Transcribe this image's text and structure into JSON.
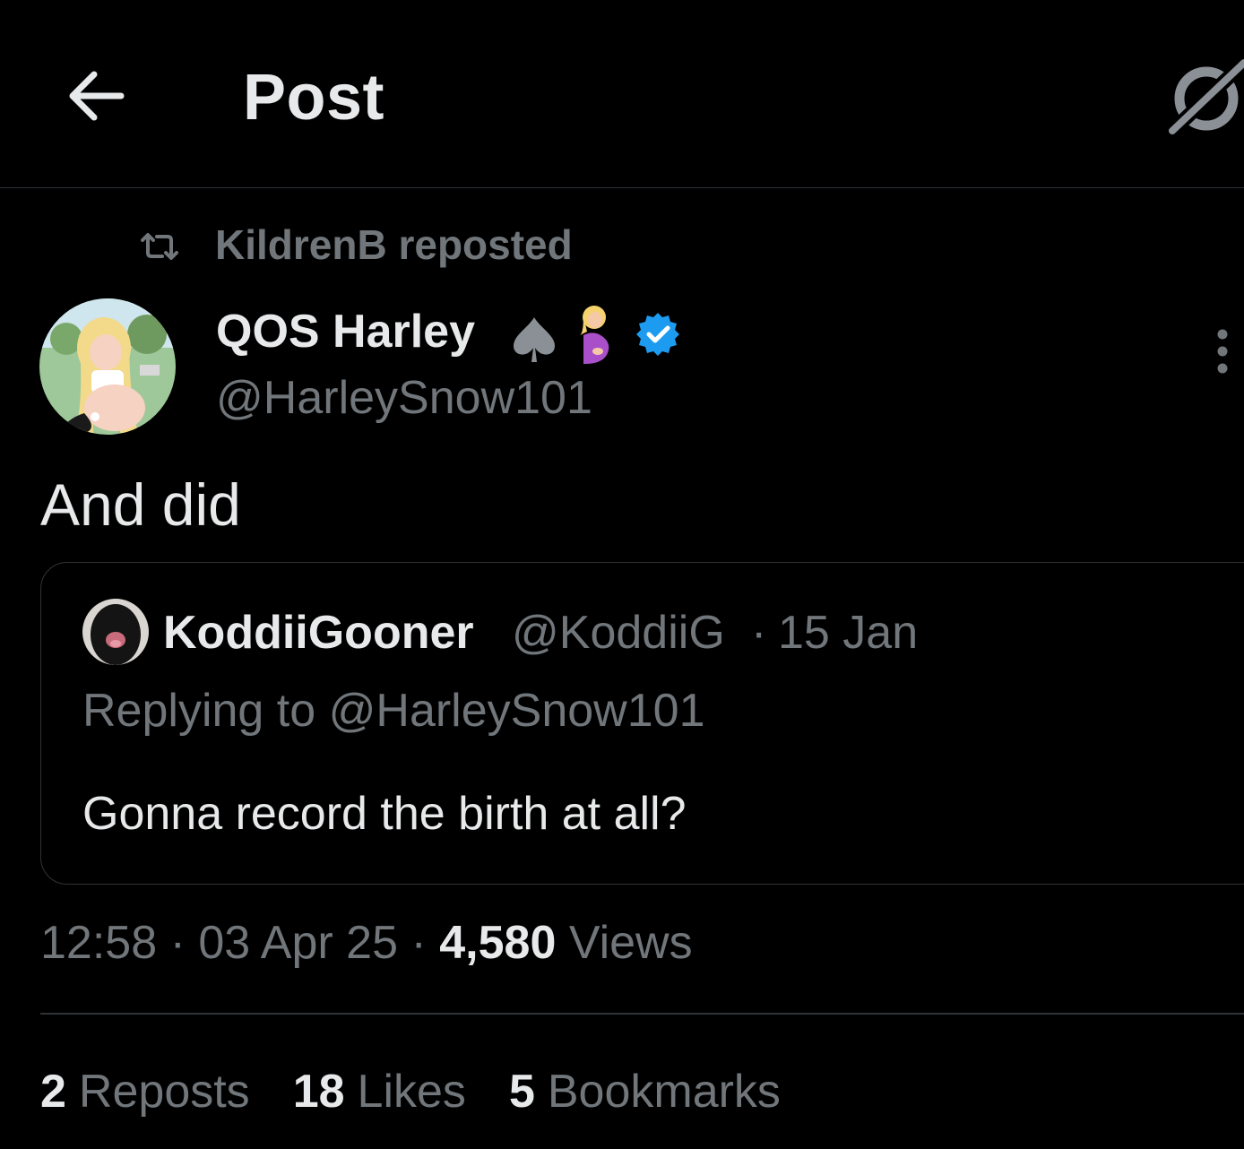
{
  "header": {
    "title": "Post",
    "back_icon": "arrow-left-icon",
    "grok_icon": "grok-icon"
  },
  "repost": {
    "icon": "repost-icon",
    "text": "KildrenB reposted"
  },
  "author": {
    "name": "QOS Harley",
    "name_emoji": [
      "spade-icon",
      "pregnant-woman-emoji"
    ],
    "verified": true,
    "handle": "@HarleySnow101"
  },
  "post": {
    "text": "And did"
  },
  "quote": {
    "name": "KoddiiGooner",
    "handle": "@KoddiiG",
    "separator": "·",
    "date": "15 Jan",
    "replying_to": "Replying to @HarleySnow101",
    "text": "Gonna record the birth at all?"
  },
  "meta": {
    "time": "12:58",
    "separator": "·",
    "date": "03 Apr 25",
    "views_count": "4,580",
    "views_label": "Views"
  },
  "stats": {
    "reposts_count": "2",
    "reposts_label": "Reposts",
    "likes_count": "18",
    "likes_label": "Likes",
    "bookmarks_count": "5",
    "bookmarks_label": "Bookmarks"
  },
  "colors": {
    "background": "#000000",
    "text_primary": "#e7e9ea",
    "text_secondary": "#71767b",
    "border": "#2f3336",
    "verified_blue": "#1d9bf0"
  }
}
